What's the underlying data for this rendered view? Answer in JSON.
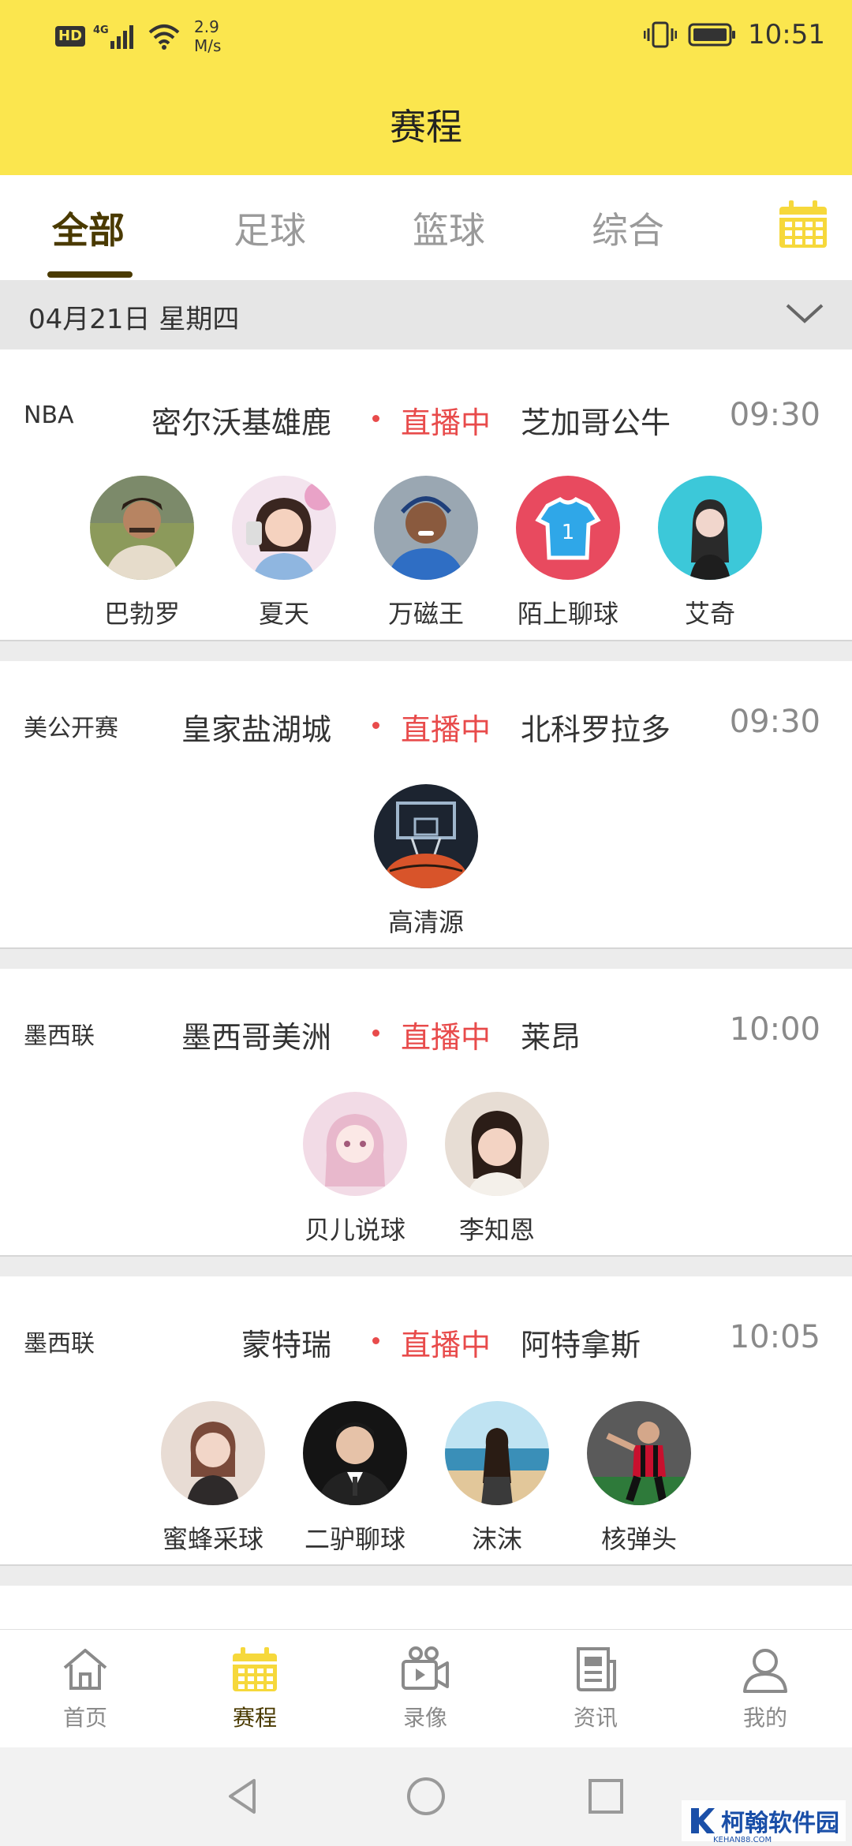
{
  "status_bar": {
    "hd": "HD",
    "network": "4G",
    "speed_value": "2.9",
    "speed_unit": "M/s",
    "time": "10:51"
  },
  "header": {
    "title": "赛程"
  },
  "tabs": [
    {
      "label": "全部",
      "active": true
    },
    {
      "label": "足球",
      "active": false
    },
    {
      "label": "篮球",
      "active": false
    },
    {
      "label": "综合",
      "active": false
    }
  ],
  "date_bar": {
    "date": "04月21日 星期四"
  },
  "matches": [
    {
      "league": "NBA",
      "home": "密尔沃基雄鹿",
      "status": "直播中",
      "away": "芝加哥公牛",
      "time": "09:30",
      "streamers": [
        "巴勃罗",
        "夏天",
        "万磁王",
        "陌上聊球",
        "艾奇"
      ]
    },
    {
      "league": "美公开赛",
      "home": "皇家盐湖城",
      "status": "直播中",
      "away": "北科罗拉多",
      "time": "09:30",
      "streamers": [
        "高清源"
      ]
    },
    {
      "league": "墨西联",
      "home": "墨西哥美洲",
      "status": "直播中",
      "away": "莱昂",
      "time": "10:00",
      "streamers": [
        "贝儿说球",
        "李知恩"
      ]
    },
    {
      "league": "墨西联",
      "home": "蒙特瑞",
      "status": "直播中",
      "away": "阿特拿斯",
      "time": "10:05",
      "streamers": [
        "蜜蜂采球",
        "二驴聊球",
        "沫沫",
        "核弹头"
      ]
    }
  ],
  "bottom_nav": [
    {
      "label": "首页",
      "icon": "home-icon"
    },
    {
      "label": "赛程",
      "icon": "calendar-icon"
    },
    {
      "label": "录像",
      "icon": "video-icon"
    },
    {
      "label": "资讯",
      "icon": "news-icon"
    },
    {
      "label": "我的",
      "icon": "profile-icon"
    }
  ],
  "watermark": {
    "text": "柯翰软件园",
    "sub": "KEHAN88.COM"
  },
  "colors": {
    "header_bg": "#fbe64e",
    "live_red": "#e84b4b",
    "active_dark": "#4a3a00",
    "calendar_yellow": "#f6d83b"
  }
}
